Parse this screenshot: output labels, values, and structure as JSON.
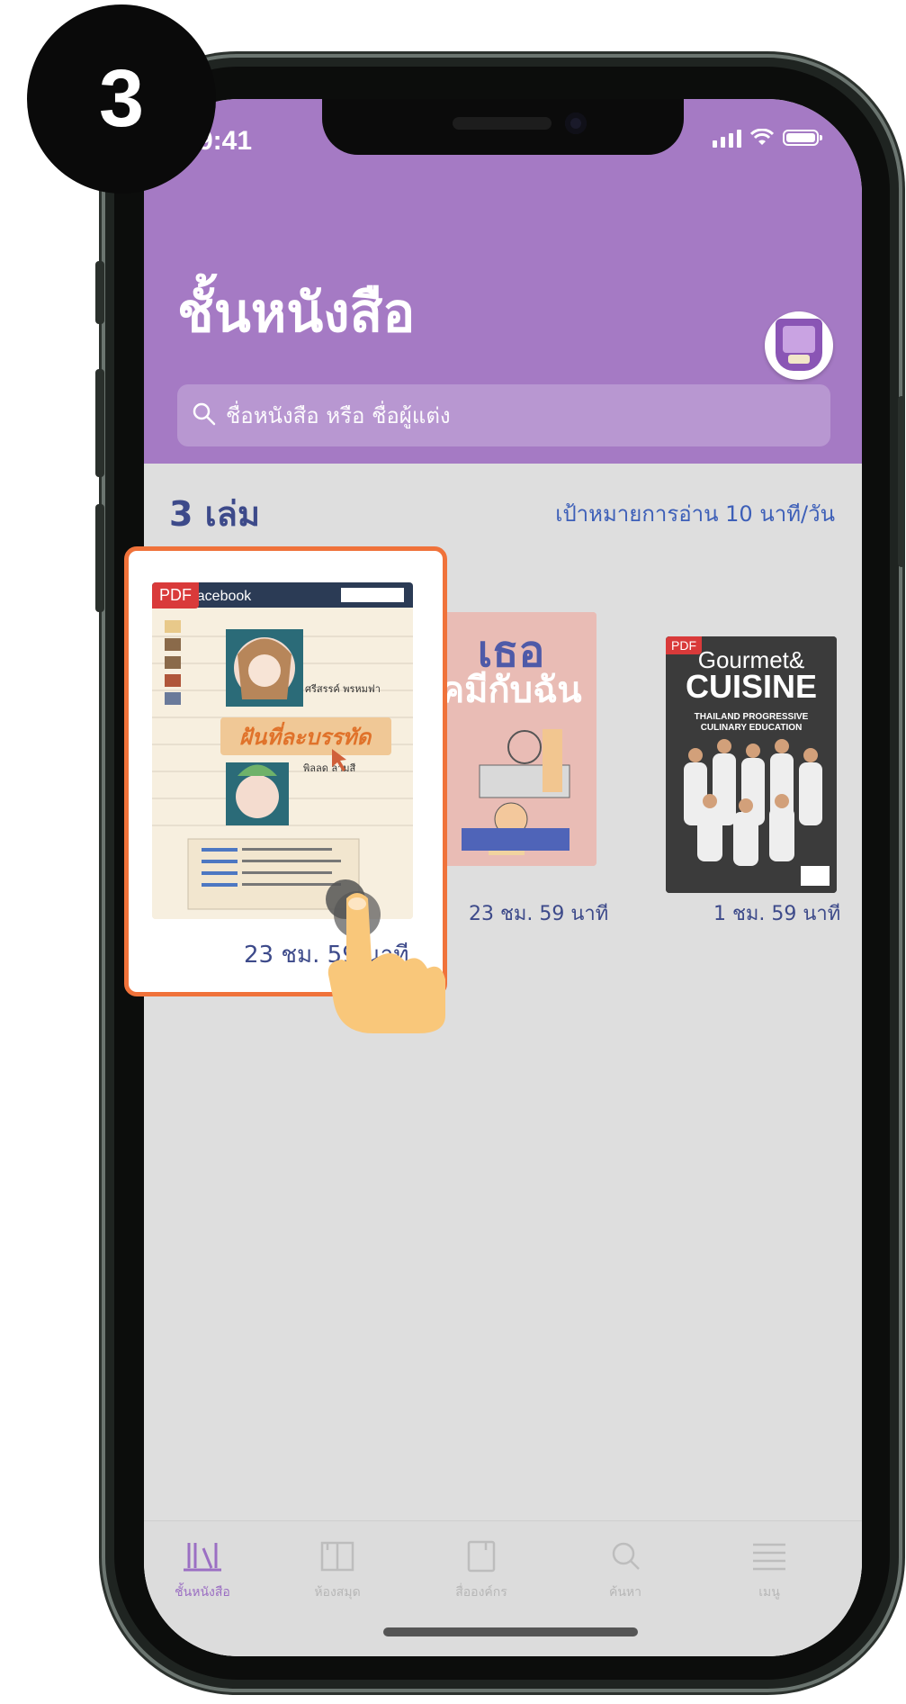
{
  "step": "3",
  "status_bar": {
    "time": "9:41"
  },
  "header": {
    "title": "ชั้นหนังสือ",
    "search_placeholder": "ชื่อหนังสือ หรือ ชื่อผู้แต่ง"
  },
  "shelf": {
    "count_label": "3 เล่ม",
    "goal_label": "เป้าหมายการอ่าน 10 นาที/วัน",
    "books": [
      {
        "badge": "PDF",
        "time": "23 ชม. 59 นาที",
        "cover_title": "ฝันที่ละบรรทัด",
        "cover_names": [
          "ศรีสรรค์ พรหมฟา",
          "พิลลด ลามสี"
        ],
        "cover_top": "Facebook"
      },
      {
        "time": "23 ชม. 59 นาที",
        "cover_title": "เธอ คมีกับฉัน"
      },
      {
        "badge": "PDF",
        "time": "1 ชม. 59 นาที",
        "cover_title": "Gourmet & Cuisine",
        "cover_sub": "THAILAND PROGRESSIVE CULINARY EDUCATION"
      }
    ]
  },
  "tabbar": {
    "items": [
      {
        "label": "ชั้นหนังสือ",
        "icon": "bookshelf-icon",
        "active": true
      },
      {
        "label": "ห้องสมุด",
        "icon": "library-icon",
        "active": false
      },
      {
        "label": "สื่อองค์กร",
        "icon": "book-icon",
        "active": false
      },
      {
        "label": "ค้นหา",
        "icon": "search-icon",
        "active": false
      },
      {
        "label": "เมนู",
        "icon": "menu-icon",
        "active": false
      }
    ]
  },
  "colors": {
    "header": "#a57ac4",
    "accent_text": "#3d4a8a",
    "highlight_border": "#f0723a",
    "pdf_badge": "#d93a3a"
  }
}
